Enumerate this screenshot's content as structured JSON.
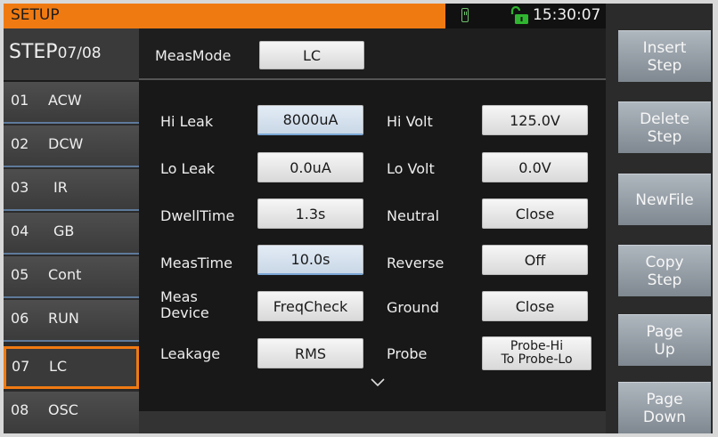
{
  "header": {
    "title": "SETUP",
    "time": "15:30:07"
  },
  "step": {
    "prefix": "STEP",
    "current": "07",
    "total": "/08"
  },
  "steps": [
    {
      "num": "01",
      "label": "ACW"
    },
    {
      "num": "02",
      "label": "DCW"
    },
    {
      "num": "03",
      "label": "IR"
    },
    {
      "num": "04",
      "label": "GB"
    },
    {
      "num": "05",
      "label": "Cont"
    },
    {
      "num": "06",
      "label": "RUN"
    },
    {
      "num": "07",
      "label": "LC"
    },
    {
      "num": "08",
      "label": "OSC"
    }
  ],
  "mode": {
    "label": "MeasMode",
    "value": "LC"
  },
  "params": {
    "hi_leak": {
      "label": "Hi Leak",
      "value": "8000uA"
    },
    "hi_volt": {
      "label": "Hi Volt",
      "value": "125.0V"
    },
    "lo_leak": {
      "label": "Lo Leak",
      "value": "0.0uA"
    },
    "lo_volt": {
      "label": "Lo Volt",
      "value": "0.0V"
    },
    "dwell": {
      "label": "DwellTime",
      "value": "1.3s"
    },
    "neutral": {
      "label": "Neutral",
      "value": "Close"
    },
    "meastime": {
      "label": "MeasTime",
      "value": "10.0s"
    },
    "reverse": {
      "label": "Reverse",
      "value": "Off"
    },
    "device": {
      "label1": "Meas",
      "label2": "Device",
      "value": "FreqCheck"
    },
    "ground": {
      "label": "Ground",
      "value": "Close"
    },
    "leakage": {
      "label": "Leakage",
      "value": "RMS"
    },
    "probe": {
      "label": "Probe",
      "value1": "Probe-Hi",
      "value2": "To Probe-Lo"
    }
  },
  "softkeys": [
    {
      "line1": "Insert",
      "line2": "Step"
    },
    {
      "line1": "Delete",
      "line2": "Step"
    },
    {
      "line1": "NewFile",
      "line2": ""
    },
    {
      "line1": "Copy",
      "line2": "Step"
    },
    {
      "line1": "Page",
      "line2": "Up"
    },
    {
      "line1": "Page",
      "line2": "Down"
    }
  ],
  "colors": {
    "accent": "#f07a12",
    "selected": "#7aa6d6",
    "unlock": "#2fb52f"
  }
}
